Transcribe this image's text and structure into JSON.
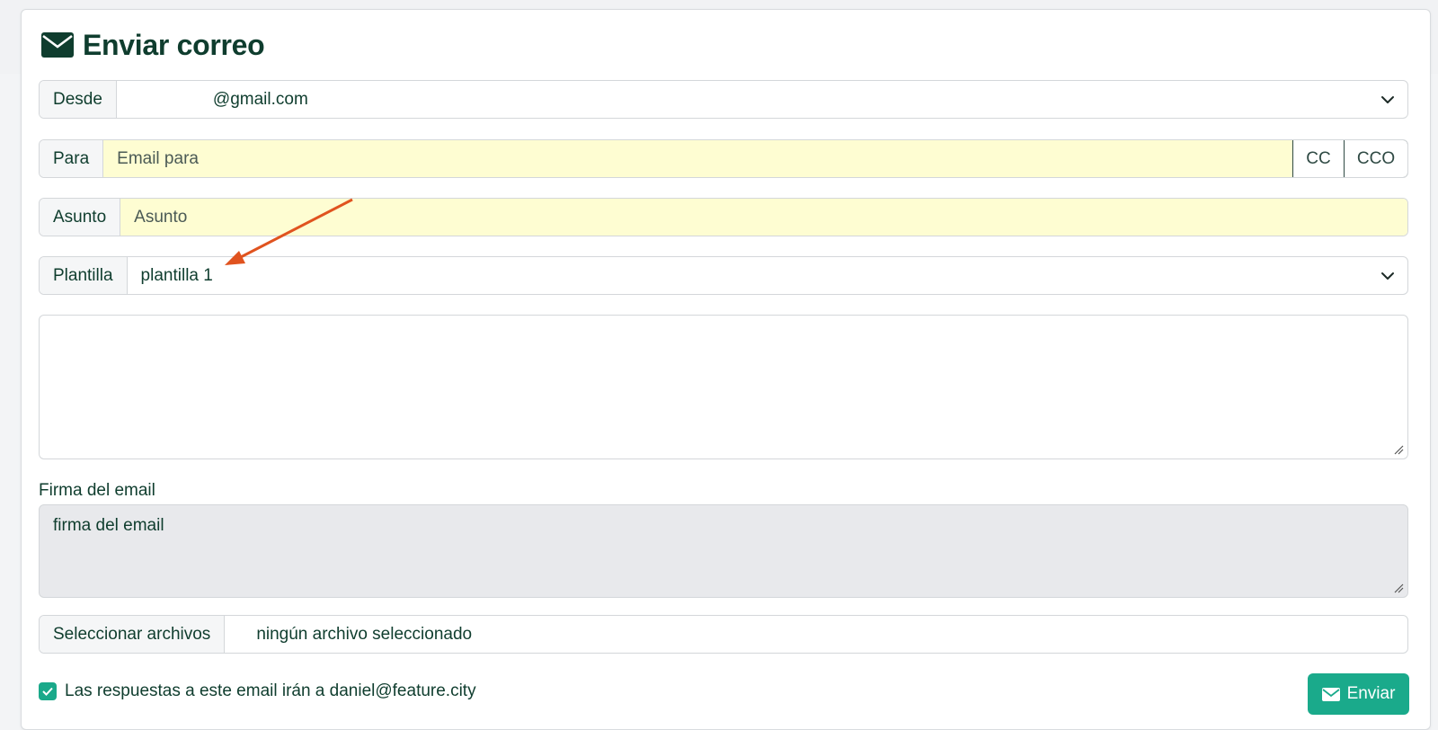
{
  "header": {
    "title": "Enviar correo",
    "icon": "envelope-icon"
  },
  "form": {
    "from": {
      "label": "Desde",
      "value": "@gmail.com"
    },
    "to": {
      "label": "Para",
      "placeholder": "Email para",
      "cc_label": "CC",
      "bcc_label": "CCO"
    },
    "subject": {
      "label": "Asunto",
      "placeholder": "Asunto"
    },
    "template": {
      "label": "Plantilla",
      "value": "plantilla 1"
    },
    "body": {
      "value": ""
    },
    "signature": {
      "label": "Firma del email",
      "value": "firma del email"
    },
    "attachments": {
      "button_label": "Seleccionar archivos",
      "status": "ningún archivo seleccionado"
    },
    "reply_to": {
      "checked": true,
      "text": "Las respuestas a este email irán a daniel@feature.city"
    },
    "send_label": "Enviar"
  },
  "colors": {
    "brand": "#0f3d2e",
    "accent": "#1aaa8b",
    "required_field_bg": "#fefdd2",
    "annotation_arrow": "#e0531f"
  }
}
